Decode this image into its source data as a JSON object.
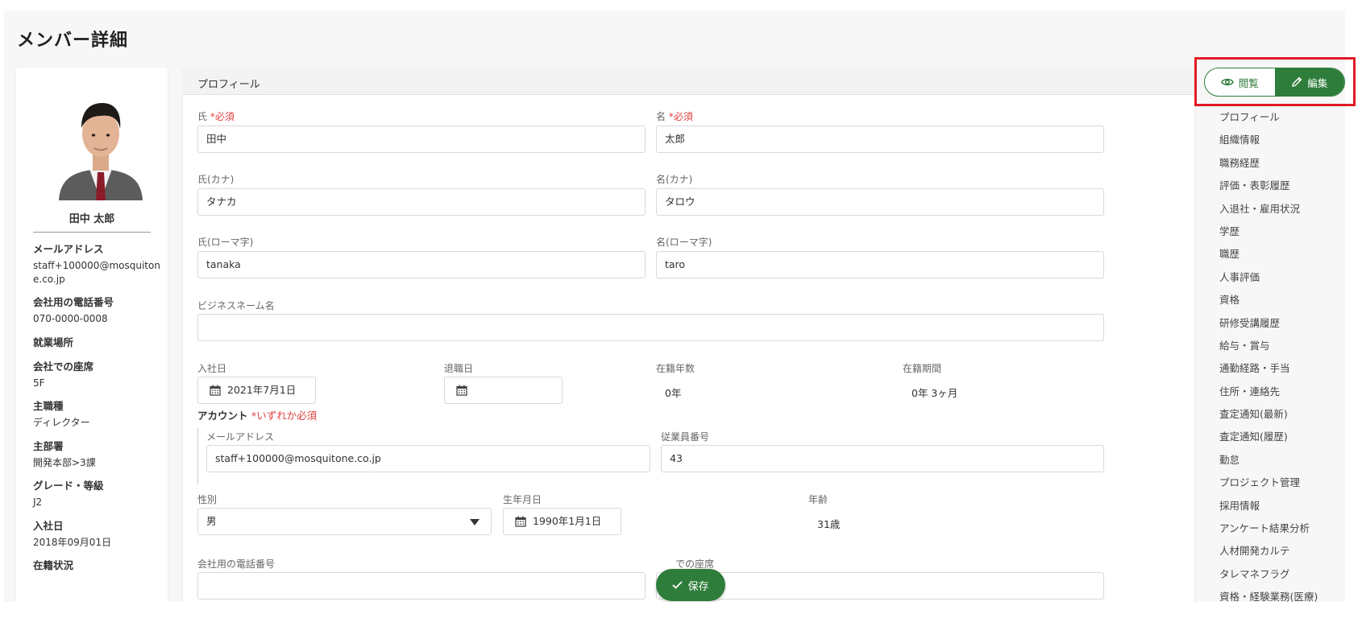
{
  "page": {
    "title": "メンバー詳細"
  },
  "profile_card": {
    "name": "田中 太郎",
    "fields": [
      {
        "label": "メールアドレス",
        "value": "staff+100000@mosquitone.co.jp"
      },
      {
        "label": "会社用の電話番号",
        "value": "070-0000-0008"
      },
      {
        "label": "就業場所",
        "value": ""
      },
      {
        "label": "会社での座席",
        "value": "5F"
      },
      {
        "label": "主職種",
        "value": "ディレクター"
      },
      {
        "label": "主部署",
        "value": "開発本部>3課"
      },
      {
        "label": "グレード・等級",
        "value": "J2"
      },
      {
        "label": "入社日",
        "value": "2018年09月01日"
      },
      {
        "label": "在籍状況",
        "value": ""
      }
    ]
  },
  "form": {
    "section_title": "プロフィール",
    "required_mark": "*必須",
    "last_name": {
      "label": "氏",
      "value": "田中"
    },
    "first_name": {
      "label": "名",
      "value": "太郎"
    },
    "last_name_kana": {
      "label": "氏(カナ)",
      "value": "タナカ"
    },
    "first_name_kana": {
      "label": "名(カナ)",
      "value": "タロウ"
    },
    "last_name_roman": {
      "label": "氏(ローマ字)",
      "value": "tanaka"
    },
    "first_name_roman": {
      "label": "名(ローマ字)",
      "value": "taro"
    },
    "business_name": {
      "label": "ビジネスネーム名",
      "value": ""
    },
    "join_date": {
      "label": "入社日",
      "value": "2021年7月1日"
    },
    "leave_date": {
      "label": "退職日",
      "value": ""
    },
    "tenure_years": {
      "label": "在籍年数",
      "value": "0年"
    },
    "tenure_period": {
      "label": "在籍期間",
      "value": "0年 3ヶ月"
    },
    "account": {
      "title": "アカウント",
      "required_mark": "*いずれか必須",
      "email": {
        "label": "メールアドレス",
        "value": "staff+100000@mosquitone.co.jp"
      },
      "employee_no": {
        "label": "従業員番号",
        "value": "43"
      }
    },
    "gender": {
      "label": "性別",
      "value": "男"
    },
    "birthday": {
      "label": "生年月日",
      "value": "1990年1月1日"
    },
    "age": {
      "label": "年齢",
      "value": "31歳"
    },
    "company_phone": {
      "label": "会社用の電話番号"
    },
    "seat": {
      "label": "での座席"
    }
  },
  "save_label": "保存",
  "mode_toggle": {
    "view_label": "閲覧",
    "edit_label": "編集"
  },
  "right_nav": {
    "items": [
      "プロフィール",
      "組織情報",
      "職務経歴",
      "評価・表彰履歴",
      "入退社・雇用状況",
      "学歴",
      "職歴",
      "人事評価",
      "資格",
      "研修受講履歴",
      "給与・賞与",
      "通勤経路・手当",
      "住所・連絡先",
      "査定通知(最新)",
      "査定通知(履歴)",
      "勤怠",
      "プロジェクト管理",
      "採用情報",
      "アンケート結果分析",
      "人材開発カルテ",
      "タレマネフラグ",
      "資格・経験業務(医療)"
    ]
  },
  "colors": {
    "accent": "#2e7d3a",
    "required": "#e04040",
    "highlight": "#e01b24"
  }
}
